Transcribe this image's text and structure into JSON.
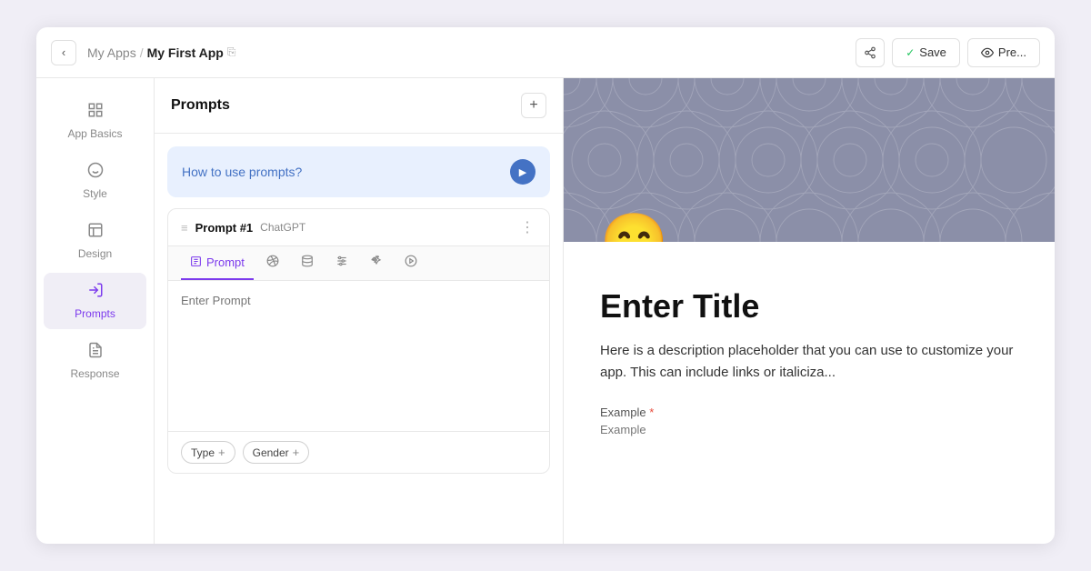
{
  "topbar": {
    "back_label": "‹",
    "breadcrumb_link": "My Apps",
    "breadcrumb_sep": "/",
    "breadcrumb_current": "My First App",
    "link_icon": "⎘",
    "share_icon": "⇧",
    "save_check": "✓",
    "save_label": "Save",
    "preview_icon": "👁",
    "preview_label": "Pre..."
  },
  "sidebar": {
    "items": [
      {
        "id": "app-basics",
        "label": "App Basics",
        "icon": "⊞"
      },
      {
        "id": "style",
        "label": "Style",
        "icon": "🎨"
      },
      {
        "id": "design",
        "label": "Design",
        "icon": "⊟"
      },
      {
        "id": "prompts",
        "label": "Prompts",
        "icon": "↗",
        "active": true
      },
      {
        "id": "response",
        "label": "Response",
        "icon": "📋"
      }
    ]
  },
  "prompts_panel": {
    "title": "Prompts",
    "add_icon": "+",
    "howto_text": "How to use prompts?",
    "play_icon": "▶",
    "prompt1": {
      "drag": "≡",
      "name": "Prompt #1",
      "model": "ChatGPT",
      "more": "⋮",
      "tabs": [
        {
          "id": "prompt",
          "label": "Prompt",
          "icon": "⊡",
          "active": true
        },
        {
          "id": "skills",
          "label": "",
          "icon": "✿"
        },
        {
          "id": "memory",
          "label": "",
          "icon": "🗄"
        },
        {
          "id": "settings",
          "label": "",
          "icon": "⚙"
        },
        {
          "id": "wand",
          "label": "",
          "icon": "✦"
        },
        {
          "id": "run",
          "label": "",
          "icon": "▷"
        }
      ],
      "placeholder": "Enter Prompt",
      "variables": [
        {
          "label": "Type",
          "icon": "+"
        },
        {
          "label": "Gender",
          "icon": "+"
        }
      ]
    }
  },
  "preview": {
    "banner_color": "#8b8fa8",
    "emoji": "😁",
    "title": "Enter Title",
    "description": "Here is a description placeholder that you can use to customize your app. This can include links or italiciza...",
    "example_label": "Example",
    "example_required": "*",
    "example_value": "Example"
  }
}
